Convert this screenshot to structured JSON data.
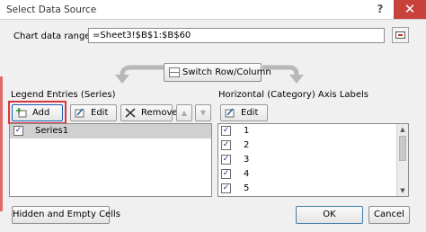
{
  "dialog": {
    "title": "Select Data Source",
    "help_glyph": "?",
    "close_glyph": "✕"
  },
  "range": {
    "label": "Chart data range:",
    "value": "=Sheet3!$B$1:$B$60"
  },
  "switch_button": {
    "label": "Switch Row/Column"
  },
  "legend": {
    "heading": "Legend Entries (Series)",
    "add_label": "Add",
    "edit_label": "Edit",
    "remove_label": "Remove",
    "up_glyph": "▲",
    "down_glyph": "▼",
    "items": [
      {
        "checked": true,
        "label": "Series1"
      }
    ]
  },
  "axis": {
    "heading": "Horizontal (Category) Axis Labels",
    "edit_label": "Edit",
    "items": [
      {
        "checked": true,
        "label": "1"
      },
      {
        "checked": true,
        "label": "2"
      },
      {
        "checked": true,
        "label": "3"
      },
      {
        "checked": true,
        "label": "4"
      },
      {
        "checked": true,
        "label": "5"
      }
    ]
  },
  "footer": {
    "hidden_empty_label": "Hidden and Empty Cells",
    "ok_label": "OK",
    "cancel_label": "Cancel"
  },
  "colors": {
    "close_button": "#c7423a",
    "highlight": "#d9363e",
    "arrow_gray": "#b8b8b8"
  }
}
